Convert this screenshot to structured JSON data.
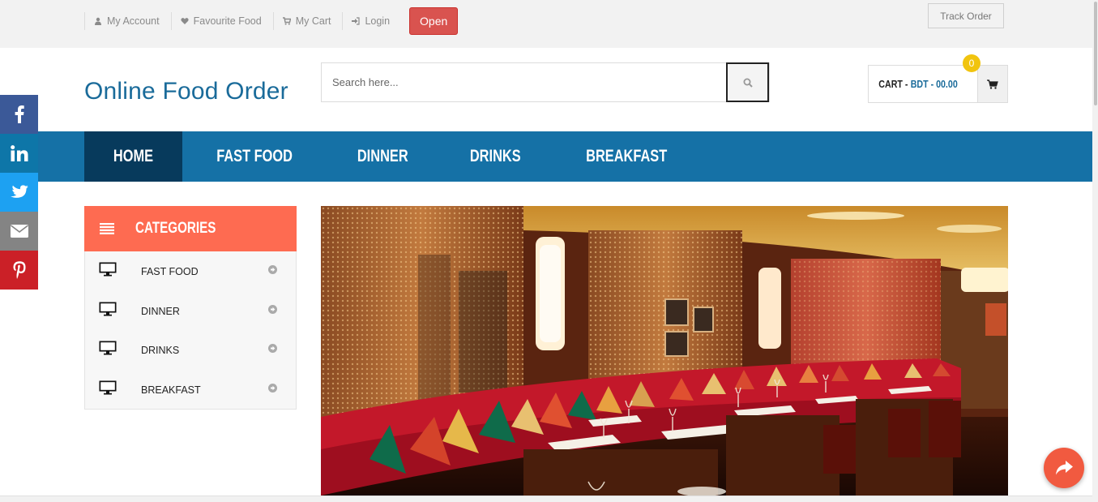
{
  "topbar": {
    "links": [
      {
        "label": "My Account",
        "icon": "user-icon"
      },
      {
        "label": "Favourite Food",
        "icon": "heart-icon"
      },
      {
        "label": "My Cart",
        "icon": "cart-icon"
      },
      {
        "label": "Login",
        "icon": "login-icon"
      }
    ],
    "open_label": "Open",
    "track_label": "Track Order"
  },
  "header": {
    "logo": "Online Food Order",
    "search_placeholder": "Search here...",
    "cart_prefix": "CART -",
    "cart_amount": "BDT - 00.00",
    "cart_count": "0"
  },
  "nav": {
    "items": [
      {
        "label": "HOME",
        "active": true
      },
      {
        "label": "FAST FOOD",
        "active": false
      },
      {
        "label": "DINNER",
        "active": false
      },
      {
        "label": "DRINKS",
        "active": false
      },
      {
        "label": "BREAKFAST",
        "active": false
      }
    ]
  },
  "categories": {
    "title": "CATEGORIES",
    "items": [
      {
        "label": "FAST FOOD"
      },
      {
        "label": "DINNER"
      },
      {
        "label": "DRINKS"
      },
      {
        "label": "BREAKFAST"
      }
    ]
  },
  "social": [
    {
      "name": "facebook-icon",
      "color": "#3b5998"
    },
    {
      "name": "linkedin-icon",
      "color": "#0e76a8"
    },
    {
      "name": "twitter-icon",
      "color": "#1da1f2"
    },
    {
      "name": "email-icon",
      "color": "#848484"
    },
    {
      "name": "pinterest-icon",
      "color": "#cb2027"
    }
  ],
  "colors": {
    "brand_blue": "#1a6b9a",
    "nav_bg": "#1571a6",
    "nav_active": "#073a5c",
    "category_header": "#fe6b51",
    "open_button": "#d9534f",
    "cart_badge": "#f1c40f",
    "share_button": "#f15a40"
  }
}
